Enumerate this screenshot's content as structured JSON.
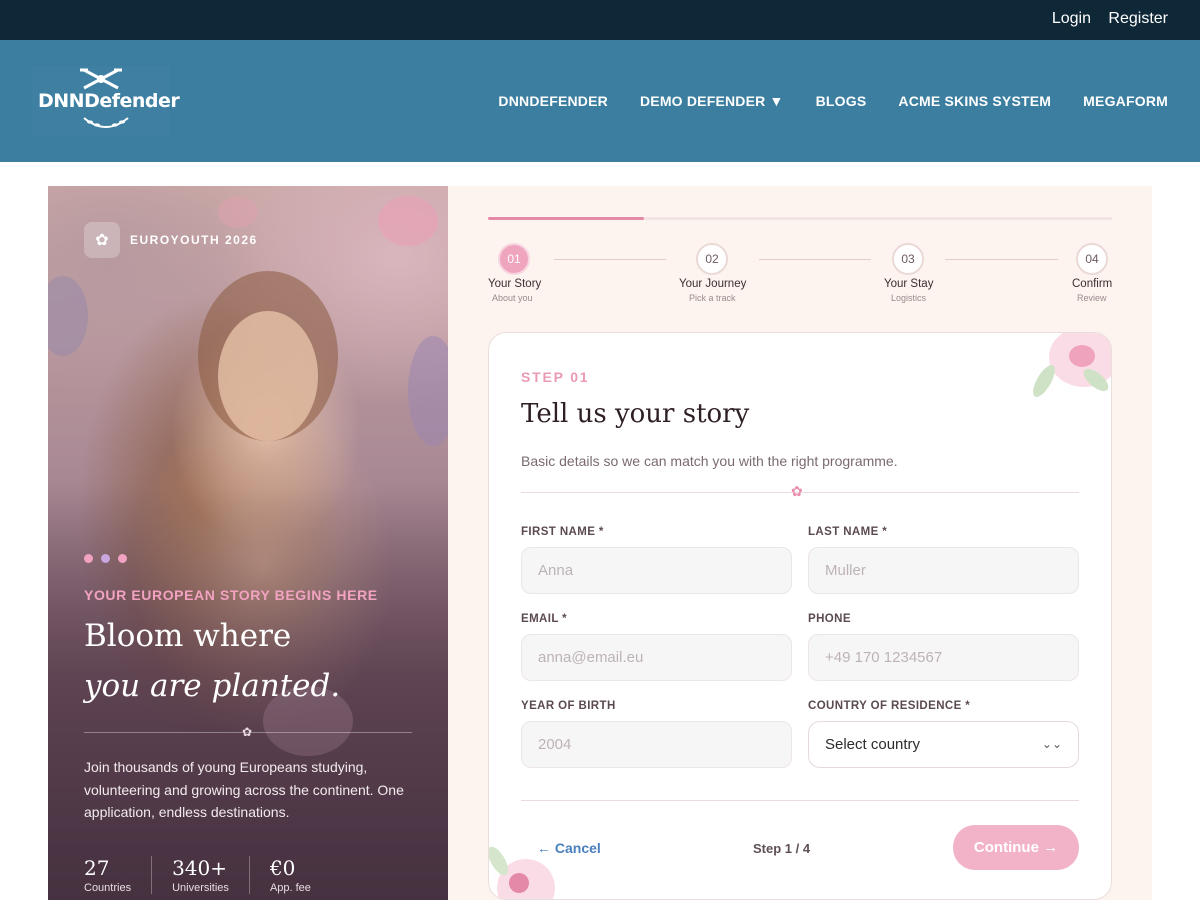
{
  "topbar": {
    "login": "Login",
    "register": "Register"
  },
  "header": {
    "logo_text": "DNNDefender",
    "nav": [
      "DNNDEFENDER",
      "DEMO DEFENDER ▼",
      "BLOGS",
      "ACME SKINS SYSTEM",
      "MEGAFORM"
    ]
  },
  "hero": {
    "brand": "EUROYOUTH 2026",
    "tagline": "YOUR EUROPEAN STORY BEGINS HERE",
    "headline_1": "Bloom where",
    "headline_2": "you are planted.",
    "paragraph": "Join thousands of young Europeans studying, volunteering and growing across the continent. One application, endless destinations.",
    "stats": [
      {
        "value": "27",
        "label": "Countries"
      },
      {
        "value": "340+",
        "label": "Universities"
      },
      {
        "value": "€0",
        "label": "App. fee"
      }
    ],
    "dot_colors": [
      "#f3a3c2",
      "#c8a6e0",
      "#f3a3c2"
    ]
  },
  "progress": {
    "fraction": 0.25
  },
  "stepper": [
    {
      "num": "01",
      "label": "Your Story",
      "sub": "About you",
      "active": true
    },
    {
      "num": "02",
      "label": "Your Journey",
      "sub": "Pick a track",
      "active": false
    },
    {
      "num": "03",
      "label": "Your Stay",
      "sub": "Logistics",
      "active": false
    },
    {
      "num": "04",
      "label": "Confirm",
      "sub": "Review",
      "active": false
    }
  ],
  "form": {
    "eyebrow": "STEP 01",
    "title": "Tell us your story",
    "description": "Basic details so we can match you with the right programme.",
    "fields": {
      "first_name": {
        "label": "FIRST NAME *",
        "placeholder": "Anna"
      },
      "last_name": {
        "label": "LAST NAME *",
        "placeholder": "Muller"
      },
      "email": {
        "label": "EMAIL *",
        "placeholder": "anna@email.eu"
      },
      "phone": {
        "label": "PHONE",
        "placeholder": "+49 170 1234567"
      },
      "year_of_birth": {
        "label": "YEAR OF BIRTH",
        "placeholder": "2004"
      },
      "country": {
        "label": "COUNTRY OF RESIDENCE *",
        "value": "Select country"
      }
    },
    "cancel": "← Cancel",
    "step_text": "Step 1 / 4",
    "continue": "Continue →"
  },
  "colors": {
    "topbar": "#0f2838",
    "header": "#3b7ea0",
    "accent_pink": "#f2b3c9",
    "eyebrow_pink": "#e99ab7",
    "form_bg": "#fdf3ef"
  }
}
